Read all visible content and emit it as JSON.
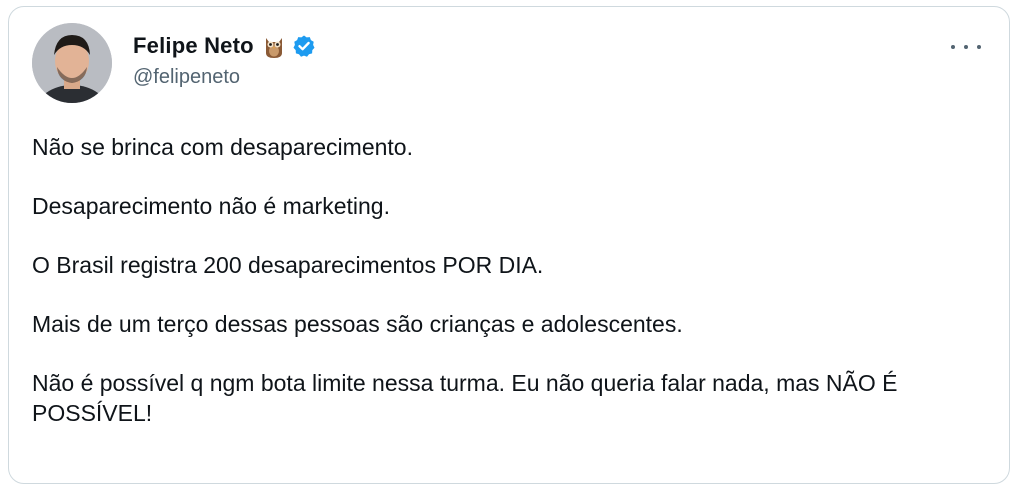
{
  "author": {
    "display_name": "Felipe Neto",
    "handle": "@felipeneto",
    "emoji_icon": "owl-icon",
    "verified_icon": "verified-badge-icon",
    "verified_color": "#1d9bf0"
  },
  "tweet": {
    "paragraphs": [
      "Não se brinca com desaparecimento.",
      "Desaparecimento não é marketing.",
      "O Brasil registra 200 desaparecimentos POR DIA.",
      "Mais de um terço dessas pessoas são crianças e adolescentes.",
      "Não é possível q ngm bota limite nessa turma. Eu não queria falar nada, mas NÃO É POSSÍVEL!"
    ]
  },
  "menu": {
    "icon": "more-options-icon"
  },
  "colors": {
    "text_primary": "#0f1419",
    "text_secondary": "#536471",
    "border": "#cfd9de"
  }
}
